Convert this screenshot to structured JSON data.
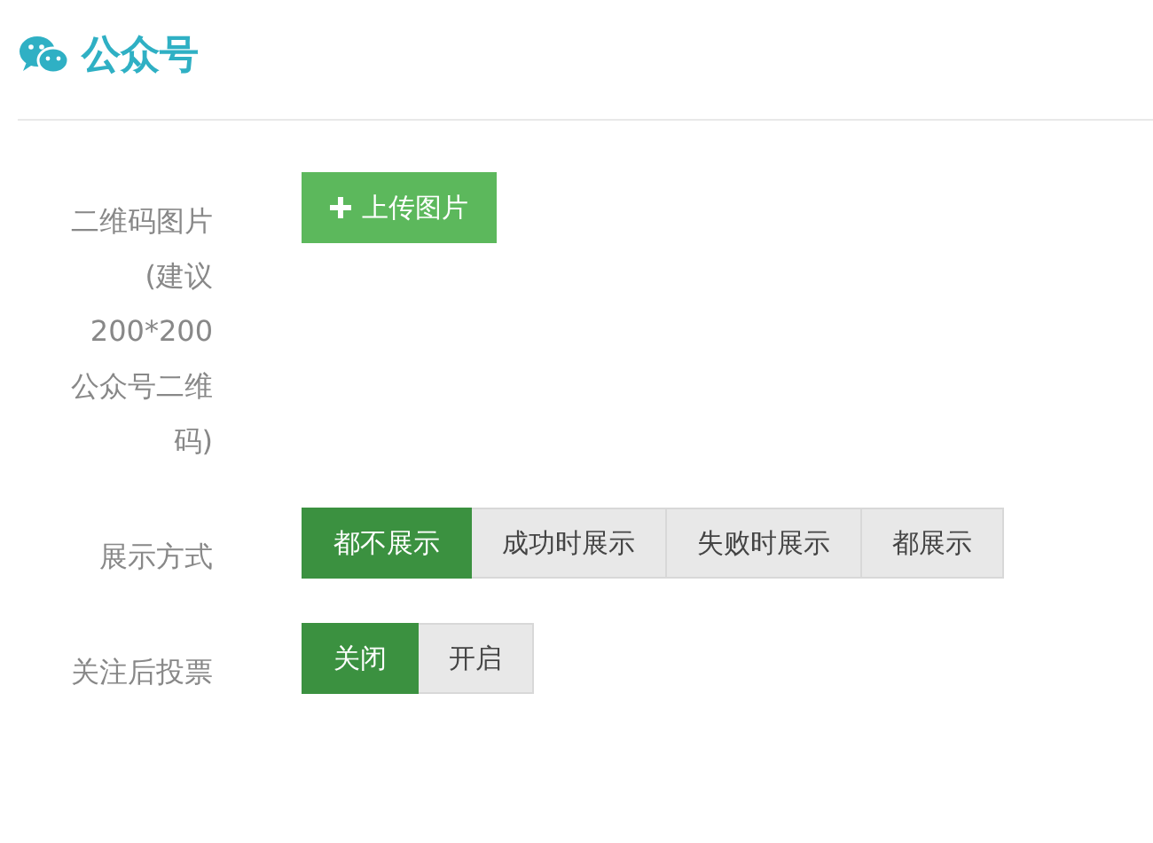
{
  "header": {
    "title": "公众号"
  },
  "fields": [
    {
      "kind": "upload",
      "label": "二维码图片(建议200*200公众号二维码)",
      "button": "上传图片"
    },
    {
      "kind": "segments",
      "label": "展示方式",
      "options": [
        {
          "label": "都不展示",
          "selected": true
        },
        {
          "label": "成功时展示",
          "selected": false
        },
        {
          "label": "失败时展示",
          "selected": false
        },
        {
          "label": "都展示",
          "selected": false
        }
      ]
    },
    {
      "kind": "segments",
      "label": "关注后投票",
      "options": [
        {
          "label": "关闭",
          "selected": true
        },
        {
          "label": "开启",
          "selected": false
        }
      ]
    }
  ]
}
